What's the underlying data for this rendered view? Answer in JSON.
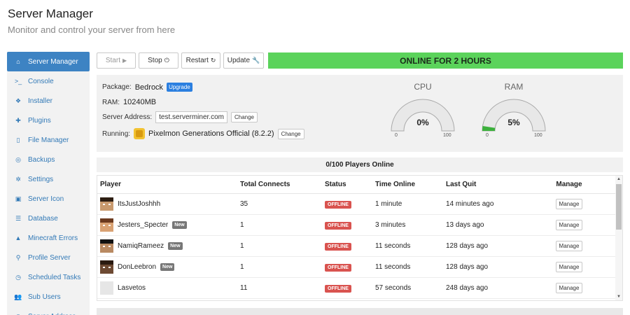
{
  "header": {
    "title": "Server Manager",
    "subtitle": "Monitor and control your server from here"
  },
  "sidebar": {
    "items": [
      {
        "label": "Server Manager",
        "icon": "home-icon",
        "glyph": "⌂"
      },
      {
        "label": "Console",
        "icon": "terminal-icon",
        "glyph": ">_"
      },
      {
        "label": "Installer",
        "icon": "cubes-icon",
        "glyph": "❖"
      },
      {
        "label": "Plugins",
        "icon": "puzzle-icon",
        "glyph": "✚"
      },
      {
        "label": "File Manager",
        "icon": "file-icon",
        "glyph": "▯"
      },
      {
        "label": "Backups",
        "icon": "life-ring-icon",
        "glyph": "◎"
      },
      {
        "label": "Settings",
        "icon": "gear-icon",
        "glyph": "✲"
      },
      {
        "label": "Server Icon",
        "icon": "image-icon",
        "glyph": "▣"
      },
      {
        "label": "Database",
        "icon": "database-icon",
        "glyph": "☰"
      },
      {
        "label": "Minecraft Errors",
        "icon": "warning-icon",
        "glyph": "▲"
      },
      {
        "label": "Profile Server",
        "icon": "search-icon",
        "glyph": "⚲"
      },
      {
        "label": "Scheduled Tasks",
        "icon": "clock-icon",
        "glyph": "◷"
      },
      {
        "label": "Sub Users",
        "icon": "users-icon",
        "glyph": "👥"
      },
      {
        "label": "Server Address",
        "icon": "globe-icon",
        "glyph": "◉"
      }
    ]
  },
  "toolbar": {
    "start_label": "Start",
    "stop_label": "Stop",
    "restart_label": "Restart",
    "update_label": "Update",
    "status_text": "ONLINE FOR 2 HOURS",
    "status_color": "#5bd35b"
  },
  "info": {
    "package_label": "Package:",
    "package_value": "Bedrock",
    "upgrade_label": "Upgrade",
    "ram_label": "RAM:",
    "ram_value": "10240MB",
    "address_label": "Server Address:",
    "address_value": "test.serverminer.com",
    "change_label": "Change",
    "running_label": "Running:",
    "running_value": "Pixelmon Generations Official (8.2.2)"
  },
  "gauges": {
    "cpu": {
      "title": "CPU",
      "value_text": "0%",
      "fraction": 0.0,
      "min": "0",
      "max": "100"
    },
    "ram": {
      "title": "RAM",
      "value_text": "5%",
      "fraction": 0.05,
      "min": "0",
      "max": "100"
    }
  },
  "players": {
    "summary": "0/100 Players Online",
    "columns": [
      "Player",
      "Total Connects",
      "Status",
      "Time Online",
      "Last Quit",
      "Manage"
    ],
    "rows": [
      {
        "name": "ItsJustJoshhh",
        "new": "",
        "connects": "35",
        "status": "OFFLINE",
        "time_online": "1 minute",
        "last_quit": "14 minutes ago",
        "manage": "Manage",
        "hair": "#2d1e12",
        "skin": "#c99a6e"
      },
      {
        "name": "Jesters_Specter",
        "new": "New",
        "connects": "1",
        "status": "OFFLINE",
        "time_online": "3 minutes",
        "last_quit": "13 days ago",
        "manage": "Manage",
        "hair": "#6b3a1f",
        "skin": "#d9a273"
      },
      {
        "name": "NamiqRameez",
        "new": "New",
        "connects": "1",
        "status": "OFFLINE",
        "time_online": "11 seconds",
        "last_quit": "128 days ago",
        "manage": "Manage",
        "hair": "#111111",
        "skin": "#b98a62"
      },
      {
        "name": "DonLeebron",
        "new": "New",
        "connects": "1",
        "status": "OFFLINE",
        "time_online": "11 seconds",
        "last_quit": "128 days ago",
        "manage": "Manage",
        "hair": "#2a1a10",
        "skin": "#6d4a33"
      },
      {
        "name": "Lasvetos",
        "new": "",
        "connects": "11",
        "status": "OFFLINE",
        "time_online": "57 seconds",
        "last_quit": "248 days ago",
        "manage": "Manage",
        "hair": "#e6e6e6",
        "skin": "#e6e6e6"
      }
    ]
  }
}
